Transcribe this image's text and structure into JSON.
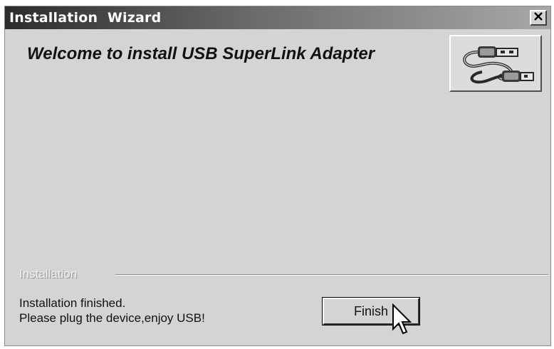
{
  "window": {
    "title": "Installation  Wizard",
    "close_glyph": "✕"
  },
  "header": {
    "welcome_text": "Welcome to install USB SuperLink Adapter",
    "logo_icon": "usb-cable-icon"
  },
  "group": {
    "label": "Installation"
  },
  "status": {
    "line1": "Installation finished.",
    "line2": "Please plug the device,enjoy USB!"
  },
  "buttons": {
    "finish_label": "Finish"
  },
  "colors": {
    "window_bg": "#d4d4d4",
    "titlebar_dark": "#2c2c2c",
    "titlebar_light": "#a8a8a8",
    "text": "#111111"
  }
}
